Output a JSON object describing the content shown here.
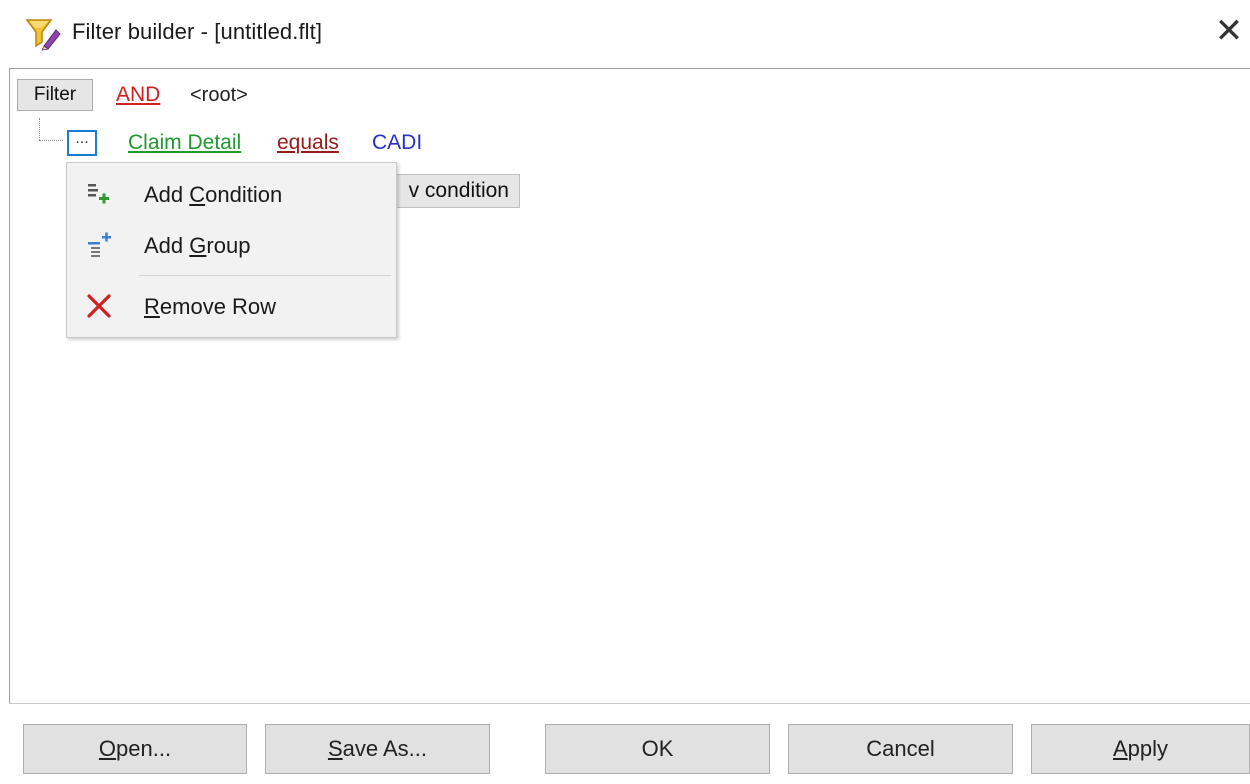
{
  "window": {
    "title": "Filter builder - [untitled.flt]",
    "icon": "filter-funnel-icon",
    "close_symbol": "✕"
  },
  "filter_tree": {
    "filter_button": "Filter",
    "root_operator": "AND",
    "root_label": "<root>",
    "condition": {
      "menu_button": "...",
      "field": "Claim Detail",
      "operator": "equals",
      "value": "CADI"
    },
    "new_condition_partial": "v condition"
  },
  "context_menu": {
    "items": [
      {
        "pre": "Add ",
        "key": "C",
        "post": "ondition",
        "icon": "add-condition-icon"
      },
      {
        "pre": "Add ",
        "key": "G",
        "post": "roup",
        "icon": "add-group-icon"
      },
      {
        "pre": "",
        "key": "R",
        "post": "emove Row",
        "icon": "remove-x-icon"
      }
    ]
  },
  "buttons": {
    "open": {
      "key": "O",
      "rest": "pen..."
    },
    "save_as": {
      "key": "S",
      "rest": "ave As..."
    },
    "ok": "OK",
    "cancel": "Cancel",
    "apply": {
      "key": "A",
      "rest": "pply"
    }
  },
  "colors": {
    "operator_and": "#d02020",
    "field_link": "#1e9a2e",
    "compare_operator": "#9a1a1a",
    "value": "#2a30c8",
    "focus_border": "#1a7dd0"
  }
}
